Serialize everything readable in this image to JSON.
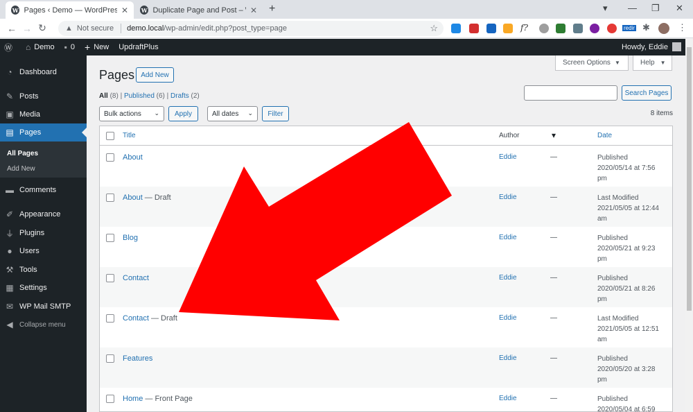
{
  "browser": {
    "tabs": [
      {
        "title": "Pages ‹ Demo — WordPress",
        "active": true
      },
      {
        "title": "Duplicate Page and Post – Word",
        "active": false
      }
    ],
    "url_security": "Not secure",
    "url_host": "demo.local",
    "url_path": "/wp-admin/edit.php?post_type=page",
    "ext_label": "redir"
  },
  "adminbar": {
    "site": "Demo",
    "comments_count": "0",
    "new_label": "New",
    "plugin": "UpdraftPlus",
    "howdy": "Howdy, Eddie"
  },
  "sidebar": {
    "items": [
      {
        "label": "Dashboard",
        "icon": "dashboard-icon"
      },
      {
        "label": "Posts",
        "icon": "pin-icon"
      },
      {
        "label": "Media",
        "icon": "media-icon"
      },
      {
        "label": "Pages",
        "icon": "page-icon"
      },
      {
        "label": "Comments",
        "icon": "comment-icon"
      },
      {
        "label": "Appearance",
        "icon": "brush-icon"
      },
      {
        "label": "Plugins",
        "icon": "plug-icon"
      },
      {
        "label": "Users",
        "icon": "user-icon"
      },
      {
        "label": "Tools",
        "icon": "wrench-icon"
      },
      {
        "label": "Settings",
        "icon": "settings-icon"
      },
      {
        "label": "WP Mail SMTP",
        "icon": "mail-icon"
      }
    ],
    "submenu": [
      "All Pages",
      "Add New"
    ],
    "collapse": "Collapse menu"
  },
  "header": {
    "screen_options": "Screen Options",
    "help": "Help",
    "title": "Pages",
    "add_new": "Add New"
  },
  "filters": {
    "all": "All",
    "all_count": "(8)",
    "published": "Published",
    "published_count": "(6)",
    "drafts": "Drafts",
    "drafts_count": "(2)",
    "bulk_actions": "Bulk actions",
    "apply": "Apply",
    "all_dates": "All dates",
    "filter": "Filter",
    "search_button": "Search Pages",
    "items_count": "8 items"
  },
  "table": {
    "headers": {
      "title": "Title",
      "author": "Author",
      "date": "Date"
    },
    "rows": [
      {
        "title": "About",
        "state": "",
        "author": "Eddie",
        "comments": "—",
        "status": "Published",
        "date": "2020/05/14 at 7:56",
        "ampm": "pm"
      },
      {
        "title": "About",
        "state": " — Draft",
        "author": "Eddie",
        "comments": "—",
        "status": "Last Modified",
        "date": "2021/05/05 at 12:44",
        "ampm": "am"
      },
      {
        "title": "Blog",
        "state": "",
        "author": "Eddie",
        "comments": "—",
        "status": "Published",
        "date": "2020/05/21 at 9:23",
        "ampm": "pm"
      },
      {
        "title": "Contact",
        "state": "",
        "author": "Eddie",
        "comments": "—",
        "status": "Published",
        "date": "2020/05/21 at 8:26",
        "ampm": "pm"
      },
      {
        "title": "Contact",
        "state": " — Draft",
        "author": "Eddie",
        "comments": "—",
        "status": "Last Modified",
        "date": "2021/05/05 at 12:51",
        "ampm": "am"
      },
      {
        "title": "Features",
        "state": "",
        "author": "Eddie",
        "comments": "—",
        "status": "Published",
        "date": "2020/05/20 at 3:28",
        "ampm": "pm"
      },
      {
        "title": "Home",
        "state": " — Front Page",
        "author": "Eddie",
        "comments": "—",
        "status": "Published",
        "date": "2020/05/04 at 6:59",
        "ampm": ""
      }
    ]
  },
  "colors": {
    "arrow": "#ff0000",
    "wp_blue": "#2271b1",
    "admin_dark": "#1d2327"
  }
}
